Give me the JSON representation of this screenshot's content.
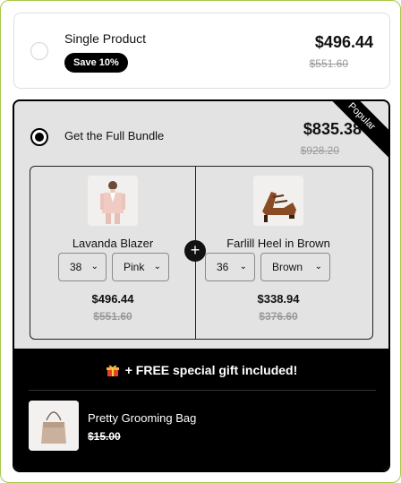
{
  "single": {
    "title": "Single Product",
    "badge": "Save 10%",
    "price": "$496.44",
    "old_price": "$551.60"
  },
  "bundle": {
    "title": "Get the Full Bundle",
    "price": "$835.38",
    "old_price": "$928.20",
    "ribbon": "Popular",
    "plus": "+",
    "products": [
      {
        "name": "Lavanda Blazer",
        "size": "38",
        "color": "Pink",
        "price": "$496.44",
        "old_price": "$551.60"
      },
      {
        "name": "Farlill Heel in Brown",
        "size": "36",
        "color": "Brown",
        "price": "$338.94",
        "old_price": "$376.60"
      }
    ]
  },
  "gift": {
    "heading": "+ FREE special gift included!",
    "item_name": "Pretty Grooming Bag",
    "item_old_price": "$15.00"
  },
  "colors": {
    "accent": "#000000",
    "bundle_bg": "#e3e3e3",
    "strike": "#9a9a9a",
    "frame": "#a8c84a"
  }
}
